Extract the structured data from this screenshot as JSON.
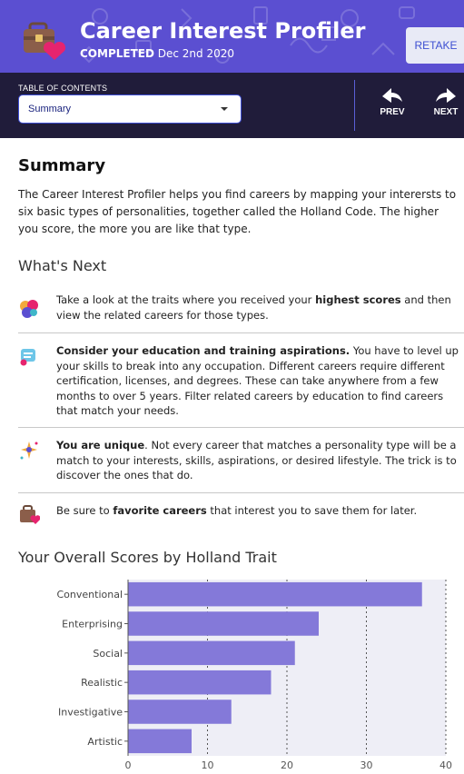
{
  "header": {
    "title": "Career Interest Profiler",
    "status": "COMPLETED",
    "date": "Dec 2nd 2020",
    "retake_label": "RETAKE",
    "icon": "briefcase-heart-icon"
  },
  "toc": {
    "label": "TABLE OF CONTENTS",
    "selected": "Summary",
    "prev_label": "PREV",
    "next_label": "NEXT"
  },
  "summary": {
    "heading": "Summary",
    "intro": "The Career Interest Profiler helps you find careers by mapping your interersts to six basic types of personalities, together called the Holland Code. The higher you score, the more you are like that type."
  },
  "whats_next": {
    "heading": "What's Next",
    "items": [
      {
        "icon": "traits-blob-icon",
        "before": "Take a look at the traits where you received your ",
        "bold": "highest scores",
        "after": " and then view the related careers for those types."
      },
      {
        "icon": "education-scroll-icon",
        "before": "",
        "bold": "Consider your education and training aspirations.",
        "after": " You have to level up your skills to break into any occupation. Different careers require different certification, licenses, and degrees. These can take anywhere from a few months to over 5 years. Filter related careers by education to find careers that match your needs."
      },
      {
        "icon": "sparkle-unique-icon",
        "before": "",
        "bold": "You are unique",
        "after": ". Not every career that matches a personality type will be a match to your interests, skills, aspirations, or desired lifestyle. The trick is to discover the ones that do."
      },
      {
        "icon": "briefcase-heart-icon",
        "before": "Be sure to ",
        "bold": "favorite careers",
        "after": " that interest you to save them for later."
      }
    ]
  },
  "scores": {
    "heading": "Your Overall Scores by Holland Trait"
  },
  "colors": {
    "header_bg": "#5b4fd1",
    "toc_bg": "#201c3a",
    "bar": "#8479d9",
    "plot_bg": "#eeeef6"
  },
  "chart_data": {
    "type": "bar",
    "orientation": "horizontal",
    "categories": [
      "Conventional",
      "Enterprising",
      "Social",
      "Realistic",
      "Investigative",
      "Artistic"
    ],
    "values": [
      37,
      24,
      21,
      18,
      13,
      8
    ],
    "xlim": [
      0,
      40
    ],
    "xticks": [
      0,
      10,
      20,
      30,
      40
    ],
    "grid": "dotted vertical",
    "title": "",
    "xlabel": "",
    "ylabel": ""
  }
}
